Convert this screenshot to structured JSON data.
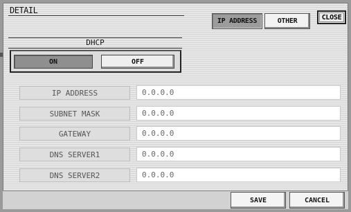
{
  "window": {
    "title": "DETAIL"
  },
  "tabs": [
    {
      "label": "IP ADDRESS",
      "selected": true
    },
    {
      "label": "OTHER",
      "selected": false
    }
  ],
  "close_label": "CLOSE",
  "dhcp": {
    "title": "DHCP",
    "on_label": "ON",
    "off_label": "OFF",
    "selected": "ON"
  },
  "fields": [
    {
      "label": "IP ADDRESS",
      "value": "0.0.0.0"
    },
    {
      "label": "SUBNET MASK",
      "value": "0.0.0.0"
    },
    {
      "label": "GATEWAY",
      "value": "0.0.0.0"
    },
    {
      "label": "DNS SERVER1",
      "value": "0.0.0.0"
    },
    {
      "label": "DNS SERVER2",
      "value": "0.0.0.0"
    }
  ],
  "footer": {
    "save_label": "SAVE",
    "cancel_label": "CANCEL"
  }
}
